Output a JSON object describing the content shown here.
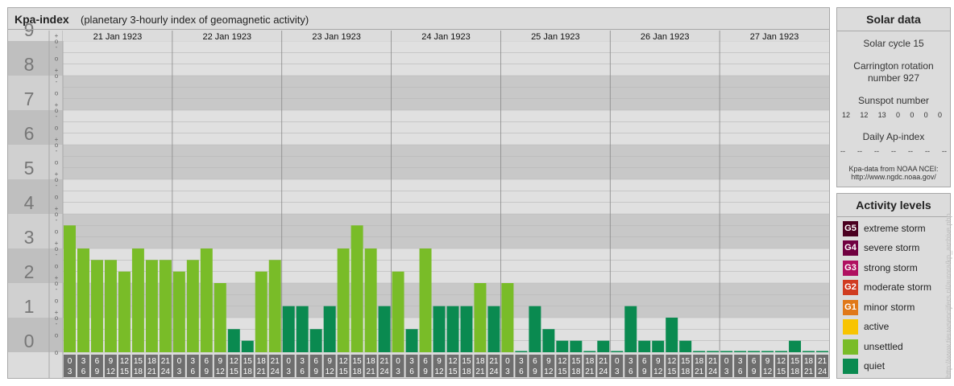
{
  "header": {
    "title": "Kpa-index",
    "subtitle": "(planetary 3-hourly index of geomagnetic activity)"
  },
  "colors": {
    "quiet": "#0a8a50",
    "unsettled": "#79bc28",
    "active": "#f8c400",
    "minor_storm": "#e07818",
    "moderate_storm": "#d03c20",
    "strong_storm": "#b01060",
    "severe_storm": "#700040",
    "extreme_storm": "#4a0020",
    "panel": "#dcdcdc",
    "band_dark": "#c8c8c8",
    "band_light": "#e0e0e0"
  },
  "chart_data": {
    "type": "bar",
    "ylim": [
      0,
      9
    ],
    "y_major_ticks": [
      "0",
      "1",
      "2",
      "3",
      "4",
      "5",
      "6",
      "7",
      "8",
      "9"
    ],
    "y_minor_ticks": [
      "+",
      "o",
      "-"
    ],
    "days": [
      "21 Jan 1923",
      "22 Jan 1923",
      "23 Jan 1923",
      "24 Jan 1923",
      "25 Jan 1923",
      "26 Jan 1923",
      "27 Jan 1923"
    ],
    "interval_starts": [
      "0",
      "3",
      "6",
      "9",
      "12",
      "15",
      "18",
      "21"
    ],
    "interval_ends": [
      "3",
      "6",
      "9",
      "12",
      "15",
      "18",
      "21",
      "24"
    ],
    "values": [
      3.667,
      3.0,
      2.667,
      2.667,
      2.333,
      3.0,
      2.667,
      2.667,
      2.333,
      2.667,
      3.0,
      2.0,
      0.667,
      0.333,
      2.333,
      2.667,
      1.333,
      1.333,
      0.667,
      1.333,
      3.0,
      3.667,
      3.0,
      1.333,
      2.333,
      0.667,
      3.0,
      1.333,
      1.333,
      1.333,
      2.0,
      1.333,
      2.0,
      0.0,
      1.333,
      0.667,
      0.333,
      0.333,
      0.0,
      0.333,
      0.0,
      1.333,
      0.333,
      0.333,
      1.0,
      0.333,
      0.0,
      0.0,
      0.0,
      0.0,
      0.0,
      0.0,
      0.0,
      0.333,
      0.0,
      0.0
    ]
  },
  "solar": {
    "title": "Solar data",
    "cycle": "Solar cycle 15",
    "carrington_line1": "Carrington rotation",
    "carrington_line2": "number 927",
    "sunspot_label": "Sunspot number",
    "sunspots": [
      "12",
      "12",
      "13",
      "0",
      "0",
      "0",
      "0"
    ],
    "ap_label": "Daily Ap-index",
    "ap_values": [
      "--",
      "--",
      "--",
      "--",
      "--",
      "--",
      "--"
    ],
    "source_line1": "Kpa-data from NOAA NCEI:",
    "source_line2": "http://www.ngdc.noaa.gov/"
  },
  "legend": {
    "title": "Activity levels",
    "items": [
      {
        "code": "G5",
        "label": "extreme storm",
        "color": "#4a0020"
      },
      {
        "code": "G4",
        "label": "severe storm",
        "color": "#700040"
      },
      {
        "code": "G3",
        "label": "strong storm",
        "color": "#b01060"
      },
      {
        "code": "G2",
        "label": "moderate storm",
        "color": "#d03c20"
      },
      {
        "code": "G1",
        "label": "minor storm",
        "color": "#e07818"
      },
      {
        "code": "",
        "label": "active",
        "color": "#f8c400"
      },
      {
        "code": "",
        "label": "unsettled",
        "color": "#79bc28"
      },
      {
        "code": "",
        "label": "quiet",
        "color": "#0a8a50"
      }
    ]
  },
  "watermark": "http://www.tieuwsencijfers.nl/aurora/kp_archive.php"
}
